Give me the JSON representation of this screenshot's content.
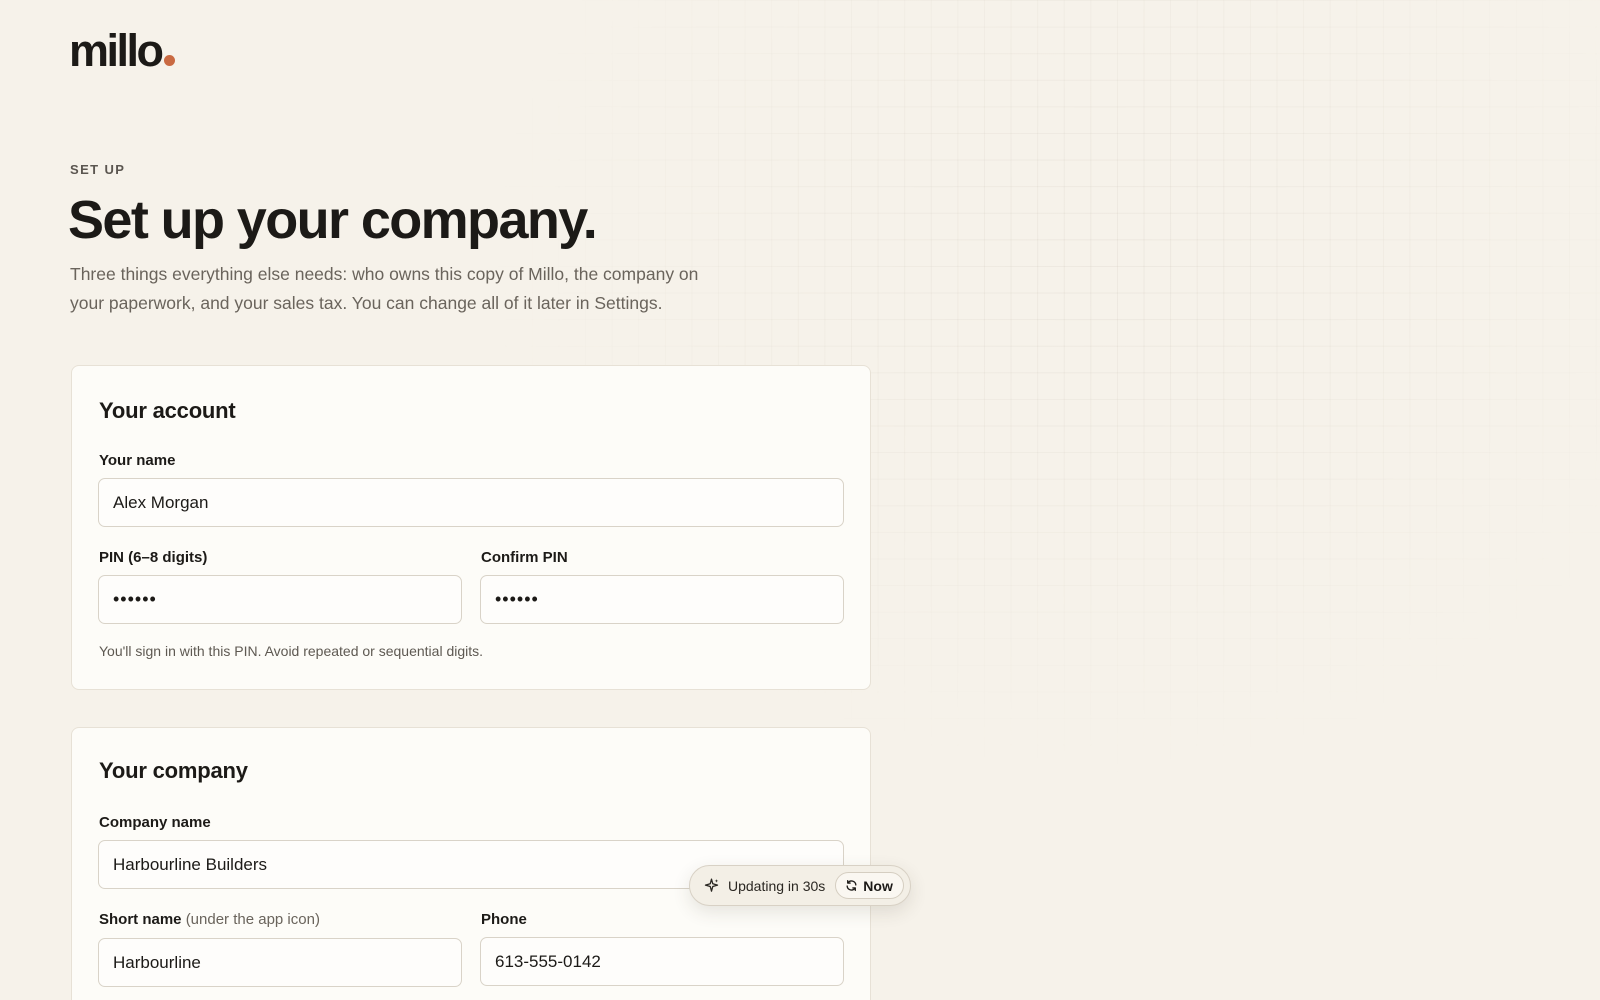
{
  "brand": {
    "name": "millo",
    "dot_color": "#c96a42"
  },
  "header": {
    "eyebrow": "SET UP",
    "title": "Set up your company.",
    "intro": "Three things everything else needs: who owns this copy of Millo, the company on your paperwork, and your sales tax. You can change all of it later in Settings."
  },
  "account": {
    "title": "Your account",
    "name_label": "Your name",
    "name_value": "Alex Morgan",
    "pin_label": "PIN (6–8 digits)",
    "pin_value": "••••••",
    "confirm_pin_label": "Confirm PIN",
    "confirm_pin_value": "••••••",
    "hint": "You'll sign in with this PIN. Avoid repeated or sequential digits."
  },
  "company": {
    "title": "Your company",
    "company_name_label": "Company name",
    "company_name_value": "Harbourline Builders",
    "short_name_label": "Short name",
    "short_name_note": "(under the app icon)",
    "short_name_value": "Harbourline",
    "phone_label": "Phone",
    "phone_value": "613-555-0142"
  },
  "toast": {
    "icon": "sparkle-icon",
    "text": "Updating in 30s",
    "button_icon": "refresh-icon",
    "button_label": "Now"
  },
  "colors": {
    "background": "#f6f2ea",
    "card": "#fdfcf8",
    "accent": "#c96a42",
    "text": "#1c1a17",
    "muted": "#6a645c"
  }
}
